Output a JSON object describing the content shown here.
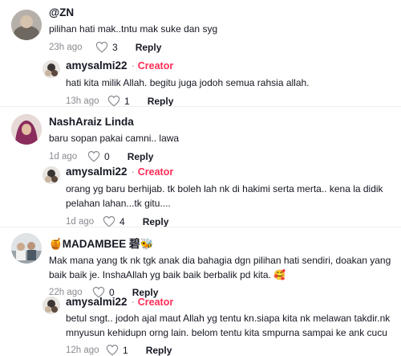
{
  "comments": [
    {
      "username": "@ZN",
      "text": "pilihan hati mak..tntu mak suke dan syg",
      "time": "23h ago",
      "likes": "3",
      "reply_label": "Reply"
    },
    {
      "username": "amysalmi22",
      "creator_label": "Creator",
      "text": "hati kita milik Allah. begitu juga jodoh semua rahsia allah.",
      "time": "13h ago",
      "likes": "1",
      "reply_label": "Reply"
    },
    {
      "username": "NashAraiz Linda",
      "text": "baru sopan pakai camni.. lawa",
      "time": "1d ago",
      "likes": "0",
      "reply_label": "Reply"
    },
    {
      "username": "amysalmi22",
      "creator_label": "Creator",
      "text": "orang yg baru berhijab. tk boleh lah nk di hakimi serta merta.. kena la didik pelahan lahan...tk gitu....",
      "time": "1d ago",
      "likes": "4",
      "reply_label": "Reply"
    },
    {
      "username": "🍯MADAMBEE 碧🐝",
      "text": "Mak mana yang tk nk tgk anak dia bahagia dgn pilihan hati sendiri, doakan yang baik baik je. InshaAllah yg baik baik berbalik pd kita. 🥰",
      "time": "22h ago",
      "likes": "0",
      "reply_label": "Reply"
    },
    {
      "username": "amysalmi22",
      "creator_label": "Creator",
      "text": "betul sngt.. jodoh ajal maut Allah yg tentu kn.siapa kita nk melawan takdir.nk mnyusun kehidupn orng lain. belom tentu kita smpurna sampai ke ank cucu",
      "time": "12h ago",
      "likes": "1",
      "reply_label": "Reply"
    }
  ],
  "colors": {
    "creator": "#fe2c55",
    "meta": "#8a8b91",
    "text": "#161823"
  },
  "icons": {
    "like": "heart-outline-icon"
  }
}
